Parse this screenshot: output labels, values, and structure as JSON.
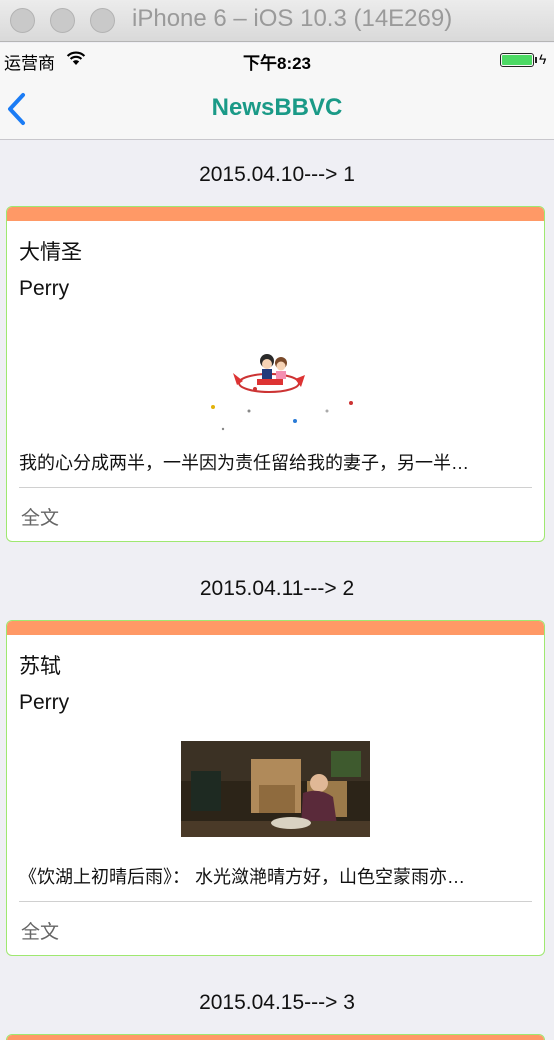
{
  "simulator": {
    "title": "iPhone 6 – iOS 10.3 (14E269)"
  },
  "status_bar": {
    "carrier": "运营商",
    "time": "下午8:23",
    "battery_level": 1.0
  },
  "navbar": {
    "title": "NewsBBVC",
    "back_icon": "chevron-left-icon"
  },
  "colors": {
    "accent": "#1a9a87",
    "card_header": "#ff9966",
    "card_border": "#9fe870",
    "back": "#1b7cf5"
  },
  "feed": [
    {
      "date": "2015.04.10---> 1",
      "title": "大情圣",
      "author": "Perry",
      "image": "cartoon-airplane-couple",
      "text": "我的心分成两半，一半因为责任留给我的妻子，另一半…",
      "more": "全文"
    },
    {
      "date": "2015.04.11---> 2",
      "title": "苏轼",
      "author": "Perry",
      "image": "photo-girl-in-room",
      "text": "《饮湖上初晴后雨》： 水光潋滟晴方好，山色空蒙雨亦…",
      "more": "全文"
    },
    {
      "date": "2015.04.15---> 3"
    }
  ]
}
